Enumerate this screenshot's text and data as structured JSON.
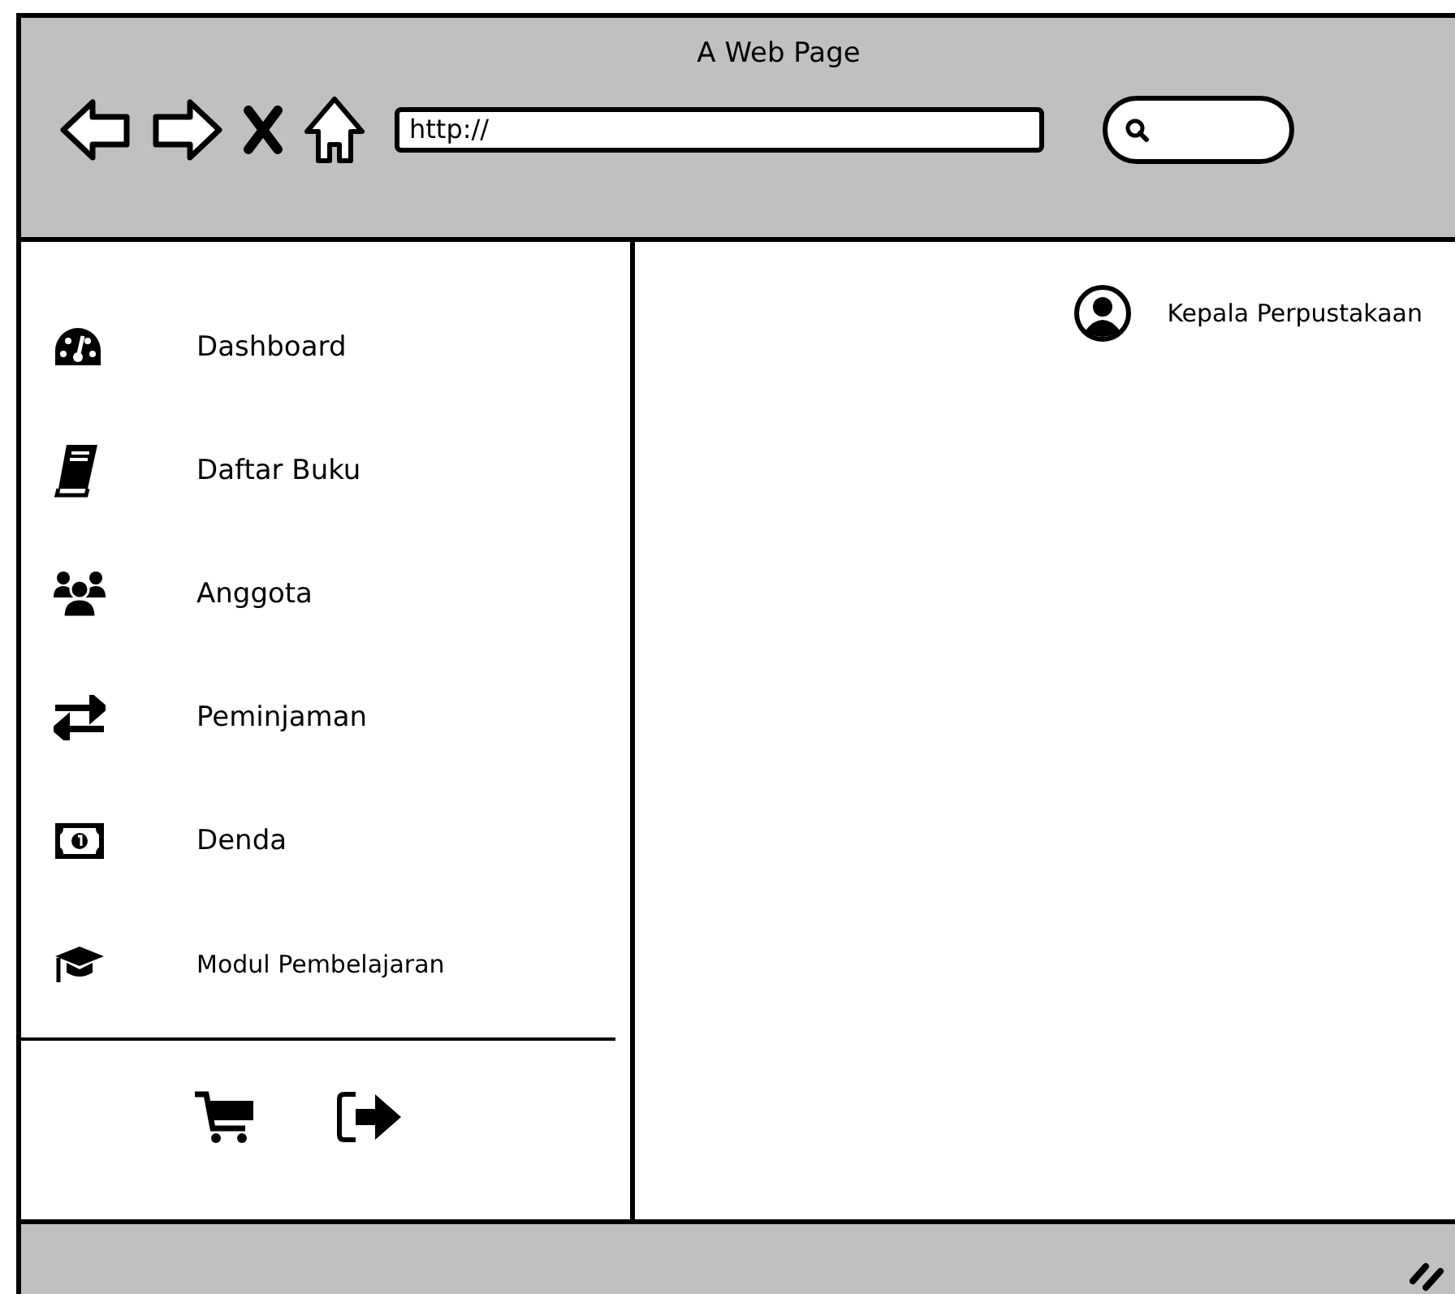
{
  "window": {
    "title": "A Web Page"
  },
  "address_bar": {
    "value": "http://"
  },
  "sidebar": {
    "items": [
      {
        "label": "Dashboard"
      },
      {
        "label": "Daftar Buku"
      },
      {
        "label": "Anggota"
      },
      {
        "label": "Peminjaman"
      },
      {
        "label": "Denda"
      },
      {
        "label": "Modul Pembelajaran"
      }
    ]
  },
  "user": {
    "name": "Kepala Perpustakaan"
  }
}
